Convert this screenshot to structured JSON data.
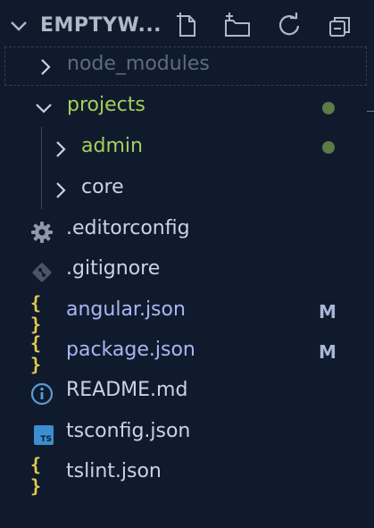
{
  "header": {
    "title": "EMPTYW...",
    "actions": [
      "new-file-icon",
      "new-folder-icon",
      "refresh-icon",
      "collapse-all-icon"
    ]
  },
  "tree": {
    "node_modules": "node_modules",
    "projects": "projects",
    "admin": "admin",
    "core": "core",
    "editorconfig": ".editorconfig",
    "gitignore": ".gitignore",
    "angular_json": "angular.json",
    "package_json": "package.json",
    "readme": "README.md",
    "tsconfig": "tsconfig.json",
    "tslint": "tslint.json"
  },
  "badges": {
    "angular_json": "M",
    "package_json": "M"
  },
  "icons": {
    "ts_label": "TS"
  },
  "colors": {
    "background": "#0f1b2d",
    "modified_folder": "#a6cf5b",
    "modified_file": "#a9b6f2",
    "text": "#c9d4e3",
    "dimmed": "#5d6b80",
    "dot": "#5d7a47",
    "json_icon": "#e8c94e",
    "ts_icon": "#3b8ed0"
  }
}
